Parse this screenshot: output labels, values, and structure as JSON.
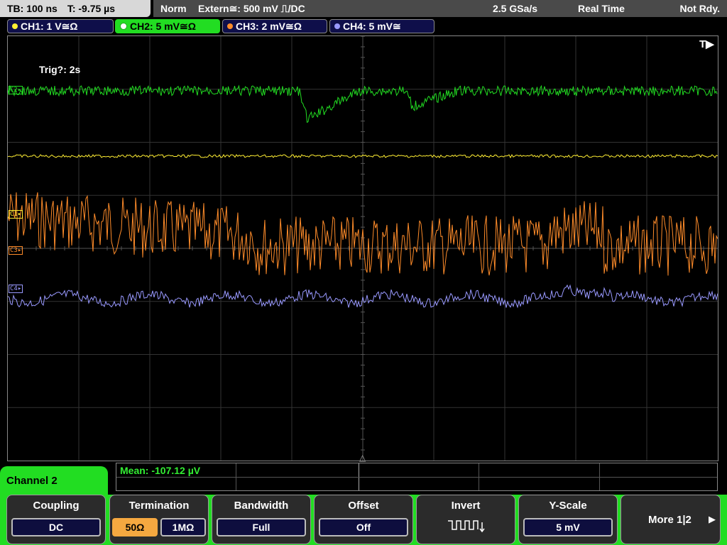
{
  "header": {
    "timebase": "TB: 100 ns",
    "trigger_time": "T: -9.75 µs",
    "trigger_mode": "Norm",
    "trigger_source": "Extern≅: 500 mV ⎍/DC",
    "sample_rate": "2.5 GSa/s",
    "acq_mode": "Real Time",
    "acq_status": "Not Rdy."
  },
  "channels": [
    {
      "label": "CH1: 1 V≅Ω",
      "color": "#ffee33"
    },
    {
      "label": "CH2: 5 mV≅Ω",
      "color": "#22dd22"
    },
    {
      "label": "CH3: 2 mV≅Ω",
      "color": "#ff8c2a"
    },
    {
      "label": "CH4: 5 mV≅",
      "color": "#9999ff"
    }
  ],
  "screen": {
    "trig_info": "Trig?: 2s",
    "t_marker": "T▶",
    "markers": {
      "c2": "C2▸",
      "c1": "C1▸",
      "c3": "C3▸",
      "c4": "C4▸"
    }
  },
  "measurement": {
    "mean": "Mean: -107.12 µV"
  },
  "menu": {
    "title": "Channel 2",
    "coupling": {
      "label": "Coupling",
      "value": "DC"
    },
    "termination": {
      "label": "Termination",
      "opt1": "50Ω",
      "opt2": "1MΩ"
    },
    "bandwidth": {
      "label": "Bandwidth",
      "value": "Full"
    },
    "offset": {
      "label": "Offset",
      "value": "Off"
    },
    "invert": {
      "label": "Invert"
    },
    "yscale": {
      "label": "Y-Scale",
      "value": "5 mV"
    },
    "more": {
      "label": "More 1|2",
      "arrow": "▶"
    }
  }
}
